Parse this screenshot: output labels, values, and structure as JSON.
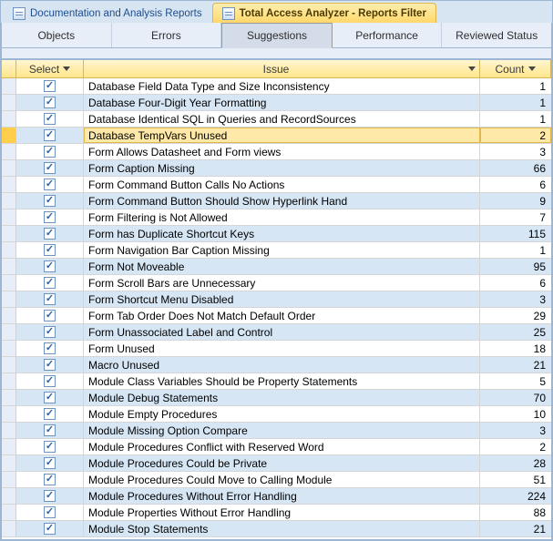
{
  "doc_tabs": {
    "inactive_label": "Documentation and Analysis Reports",
    "active_label": "Total Access Analyzer - Reports Filter"
  },
  "subtabs": {
    "objects": "Objects",
    "errors": "Errors",
    "suggestions": "Suggestions",
    "performance": "Performance",
    "reviewed": "Reviewed Status"
  },
  "grid_headers": {
    "select": "Select",
    "issue": "Issue",
    "count": "Count"
  },
  "rows": [
    {
      "checked": true,
      "issue": "Database Field Data Type and Size Inconsistency",
      "count": 1
    },
    {
      "checked": true,
      "issue": "Database Four-Digit Year Formatting",
      "count": 1
    },
    {
      "checked": true,
      "issue": "Database Identical SQL in Queries and RecordSources",
      "count": 1
    },
    {
      "checked": true,
      "issue": "Database TempVars Unused",
      "count": 2,
      "selected": true
    },
    {
      "checked": true,
      "issue": "Form Allows Datasheet and Form views",
      "count": 3
    },
    {
      "checked": true,
      "issue": "Form Caption Missing",
      "count": 66
    },
    {
      "checked": true,
      "issue": "Form Command Button Calls No Actions",
      "count": 6
    },
    {
      "checked": true,
      "issue": "Form Command Button Should Show Hyperlink Hand",
      "count": 9
    },
    {
      "checked": true,
      "issue": "Form Filtering is Not Allowed",
      "count": 7
    },
    {
      "checked": true,
      "issue": "Form has Duplicate Shortcut Keys",
      "count": 115
    },
    {
      "checked": true,
      "issue": "Form Navigation Bar Caption Missing",
      "count": 1
    },
    {
      "checked": true,
      "issue": "Form Not Moveable",
      "count": 95
    },
    {
      "checked": true,
      "issue": "Form Scroll Bars are Unnecessary",
      "count": 6
    },
    {
      "checked": true,
      "issue": "Form Shortcut Menu Disabled",
      "count": 3
    },
    {
      "checked": true,
      "issue": "Form Tab Order Does Not Match Default Order",
      "count": 29
    },
    {
      "checked": true,
      "issue": "Form Unassociated Label and Control",
      "count": 25
    },
    {
      "checked": true,
      "issue": "Form Unused",
      "count": 18
    },
    {
      "checked": true,
      "issue": "Macro Unused",
      "count": 21
    },
    {
      "checked": true,
      "issue": "Module Class Variables Should be Property Statements",
      "count": 5
    },
    {
      "checked": true,
      "issue": "Module Debug Statements",
      "count": 70
    },
    {
      "checked": true,
      "issue": "Module Empty Procedures",
      "count": 10
    },
    {
      "checked": true,
      "issue": "Module Missing Option Compare",
      "count": 3
    },
    {
      "checked": true,
      "issue": "Module Procedures Conflict with Reserved Word",
      "count": 2
    },
    {
      "checked": true,
      "issue": "Module Procedures Could be Private",
      "count": 28
    },
    {
      "checked": true,
      "issue": "Module Procedures Could Move to Calling Module",
      "count": 51
    },
    {
      "checked": true,
      "issue": "Module Procedures Without Error Handling",
      "count": 224
    },
    {
      "checked": true,
      "issue": "Module Properties Without Error Handling",
      "count": 88
    },
    {
      "checked": true,
      "issue": "Module Stop Statements",
      "count": 21
    }
  ]
}
